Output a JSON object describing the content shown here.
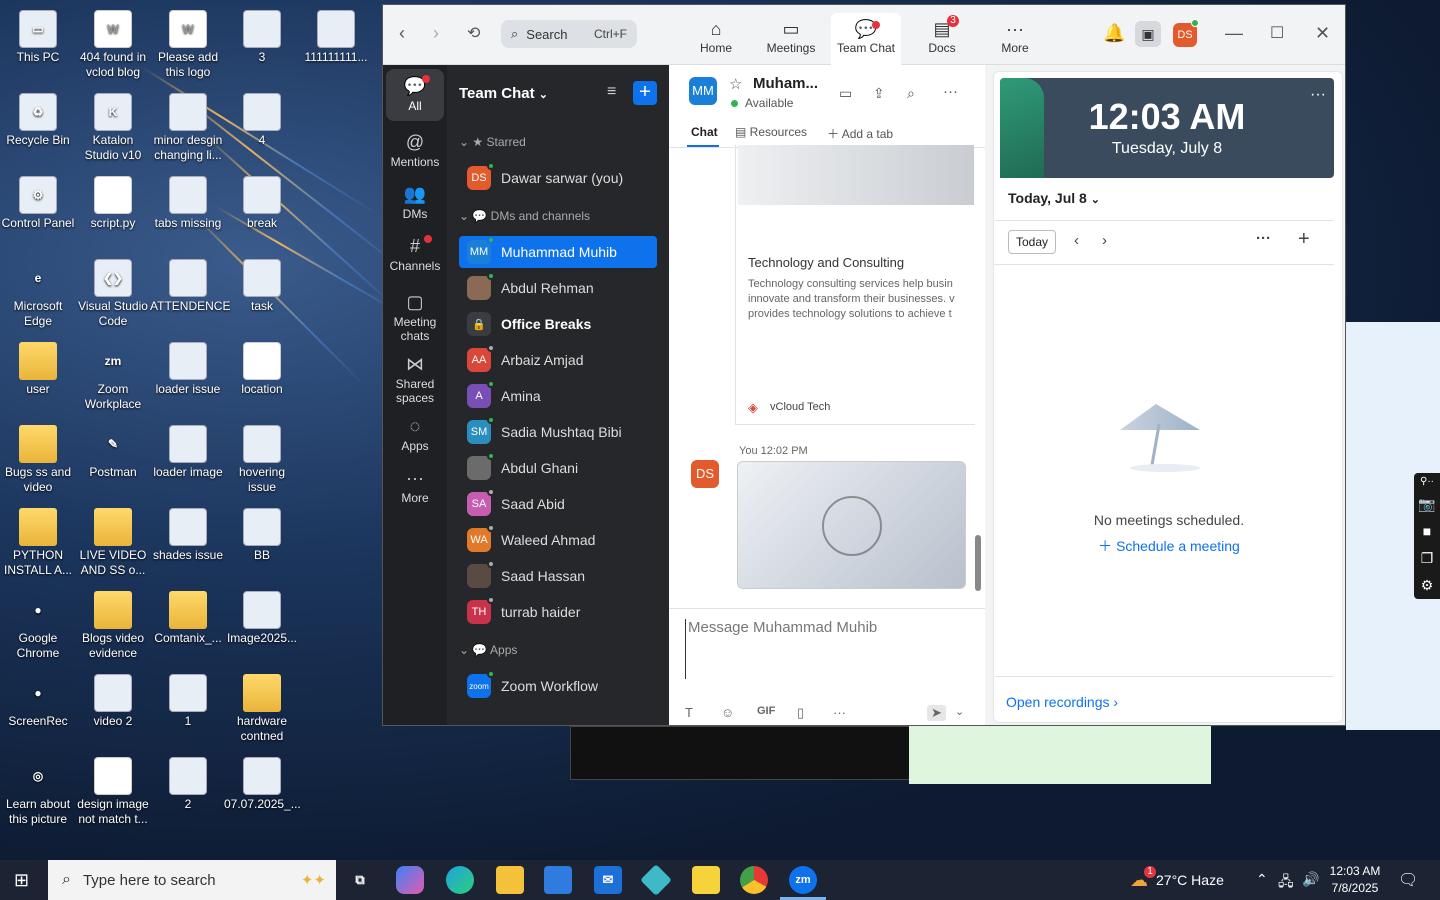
{
  "desktop": {
    "icons": [
      {
        "label": "This PC",
        "glyph": "▭",
        "kind": "img"
      },
      {
        "label": "404 found in vclod blog",
        "glyph": "W",
        "kind": "doc"
      },
      {
        "label": "Please add this logo",
        "glyph": "W",
        "kind": "doc"
      },
      {
        "label": "3",
        "glyph": "",
        "kind": "img"
      },
      {
        "label": "111111111...",
        "glyph": "",
        "kind": "img"
      },
      {
        "label": "Recycle Bin",
        "glyph": "♻",
        "kind": "img"
      },
      {
        "label": "Katalon Studio v10",
        "glyph": "K",
        "kind": "img"
      },
      {
        "label": "minor desgin changing li...",
        "glyph": "",
        "kind": "img"
      },
      {
        "label": "4",
        "glyph": "",
        "kind": "img"
      },
      {
        "label": "Control Panel",
        "glyph": "⚙",
        "kind": "img"
      },
      {
        "label": "script.py",
        "glyph": "",
        "kind": "doc"
      },
      {
        "label": "tabs missing",
        "glyph": "",
        "kind": "img"
      },
      {
        "label": "break",
        "glyph": "",
        "kind": "img"
      },
      {
        "label": "Microsoft Edge",
        "glyph": "e",
        "kind": "rnd"
      },
      {
        "label": "Visual Studio Code",
        "glyph": "❮❯",
        "kind": "img"
      },
      {
        "label": "ATTENDENCE",
        "glyph": "",
        "kind": "img"
      },
      {
        "label": "task",
        "glyph": "",
        "kind": "img"
      },
      {
        "label": "user",
        "glyph": "",
        "kind": "folder"
      },
      {
        "label": "Zoom Workplace",
        "glyph": "zm",
        "kind": "rnd"
      },
      {
        "label": "loader issue",
        "glyph": "",
        "kind": "img"
      },
      {
        "label": "location",
        "glyph": "",
        "kind": "doc"
      },
      {
        "label": "Bugs ss and video",
        "glyph": "",
        "kind": "folder"
      },
      {
        "label": "Postman",
        "glyph": "✎",
        "kind": "rnd"
      },
      {
        "label": "loader image",
        "glyph": "",
        "kind": "img"
      },
      {
        "label": "hovering issue",
        "glyph": "",
        "kind": "img"
      },
      {
        "label": "PYTHON INSTALL A...",
        "glyph": "",
        "kind": "folder"
      },
      {
        "label": "LIVE VIDEO AND SS o...",
        "glyph": "",
        "kind": "folder"
      },
      {
        "label": "shades issue",
        "glyph": "",
        "kind": "img"
      },
      {
        "label": "BB",
        "glyph": "",
        "kind": "img"
      },
      {
        "label": "Google Chrome",
        "glyph": "●",
        "kind": "rnd"
      },
      {
        "label": "Blogs video evidence",
        "glyph": "",
        "kind": "folder"
      },
      {
        "label": "Comtanix_...",
        "glyph": "",
        "kind": "folder"
      },
      {
        "label": "Image2025...",
        "glyph": "",
        "kind": "img"
      },
      {
        "label": "ScreenRec",
        "glyph": "●",
        "kind": "rnd"
      },
      {
        "label": "video 2",
        "glyph": "",
        "kind": "img"
      },
      {
        "label": "1",
        "glyph": "",
        "kind": "img"
      },
      {
        "label": "hardware contned",
        "glyph": "",
        "kind": "folder"
      },
      {
        "label": "Learn about this picture",
        "glyph": "◎",
        "kind": "rnd"
      },
      {
        "label": "design image not match t...",
        "glyph": "",
        "kind": "doc"
      },
      {
        "label": "2",
        "glyph": "",
        "kind": "img"
      },
      {
        "label": "07.07.2025_...",
        "glyph": "",
        "kind": "img"
      }
    ]
  },
  "zoom": {
    "search": {
      "label": "Search",
      "shortcut": "Ctrl+F"
    },
    "tabs": [
      {
        "label": "Home",
        "icon": "⌂"
      },
      {
        "label": "Meetings",
        "icon": "▭"
      },
      {
        "label": "Team Chat",
        "icon": "💬"
      },
      {
        "label": "Docs",
        "icon": "▤",
        "badge": "3"
      },
      {
        "label": "More",
        "icon": "···"
      }
    ],
    "user_initials": "DS",
    "rail": [
      {
        "label": "All",
        "icon": "💬"
      },
      {
        "label": "Mentions",
        "icon": "@"
      },
      {
        "label": "DMs",
        "icon": "👥"
      },
      {
        "label": "Channels",
        "icon": "#"
      },
      {
        "label": "Meeting chats",
        "icon": "▢"
      },
      {
        "label": "Shared spaces",
        "icon": "⋈"
      },
      {
        "label": "Apps",
        "icon": "◌"
      },
      {
        "label": "More",
        "icon": "···"
      }
    ],
    "chatlist": {
      "title": "Team Chat",
      "starred_label": "Starred",
      "dms_label": "DMs and channels",
      "apps_label": "Apps",
      "starred": [
        {
          "initials": "DS",
          "name": "Dawar sarwar (you)",
          "color": "#e35a2c",
          "presence": "#2fb550"
        }
      ],
      "contacts": [
        {
          "initials": "MM",
          "name": "Muhammad Muhib",
          "color": "#1a7fd6",
          "presence": "#2fb550",
          "bold": false
        },
        {
          "initials": "",
          "name": "Abdul Rehman",
          "color": "#8a6a55",
          "presence": "#2fb550",
          "bold": false
        },
        {
          "initials": "🔒",
          "name": "Office Breaks",
          "color": "#3b3c42",
          "presence": "",
          "bold": true
        },
        {
          "initials": "AA",
          "name": "Arbaiz Amjad",
          "color": "#d9473a",
          "presence": "#aaaaaa",
          "bold": false
        },
        {
          "initials": "A",
          "name": "Amina",
          "color": "#7a4fb5",
          "presence": "#2fb550",
          "bold": false
        },
        {
          "initials": "SM",
          "name": "Sadia Mushtaq Bibi",
          "color": "#2a8fbf",
          "presence": "#2fb550",
          "bold": false
        },
        {
          "initials": "",
          "name": "Abdul Ghani",
          "color": "#6b6b6b",
          "presence": "#2fb550",
          "bold": false
        },
        {
          "initials": "SA",
          "name": "Saad Abid",
          "color": "#c55db0",
          "presence": "#aaaaaa",
          "bold": false
        },
        {
          "initials": "WA",
          "name": "Waleed Ahmad",
          "color": "#e07a2a",
          "presence": "#aaaaaa",
          "bold": false
        },
        {
          "initials": "",
          "name": "Saad Hassan",
          "color": "#5a4a44",
          "presence": "#aaaaaa",
          "bold": false
        },
        {
          "initials": "TH",
          "name": "turrab haider",
          "color": "#c8324a",
          "presence": "#aaaaaa",
          "bold": false
        }
      ],
      "apps": [
        {
          "initials": "zoom",
          "name": "Zoom Workflow",
          "color": "#0e72ed",
          "presence": "#2fb550"
        }
      ]
    },
    "chat": {
      "initials": "MM",
      "name": "Muham...",
      "status": "Available",
      "tab_chat": "Chat",
      "tab_resources": "Resources",
      "tab_add": "Add a tab",
      "card_title": "Technology and Consulting",
      "card_desc": "Technology consulting services help busin innovate and transform their businesses. v provides technology solutions to achieve t",
      "card_source": "vCloud Tech",
      "msg_sender": "You",
      "msg_time": "12:02 PM",
      "msg_initials": "DS",
      "composer_placeholder": "Message Muhammad Muhib",
      "tool_gif": "GIF"
    },
    "calendar": {
      "time": "12:03 AM",
      "date": "Tuesday, July 8",
      "day_label": "Today, Jul 8",
      "today_btn": "Today",
      "empty_text": "No meetings scheduled.",
      "schedule_link": "Schedule a meeting",
      "recordings_link": "Open recordings"
    }
  },
  "taskbar": {
    "search_placeholder": "Type here to search",
    "weather": "27°C  Haze",
    "weather_badge": "1",
    "time": "12:03 AM",
    "date": "7/8/2025"
  }
}
